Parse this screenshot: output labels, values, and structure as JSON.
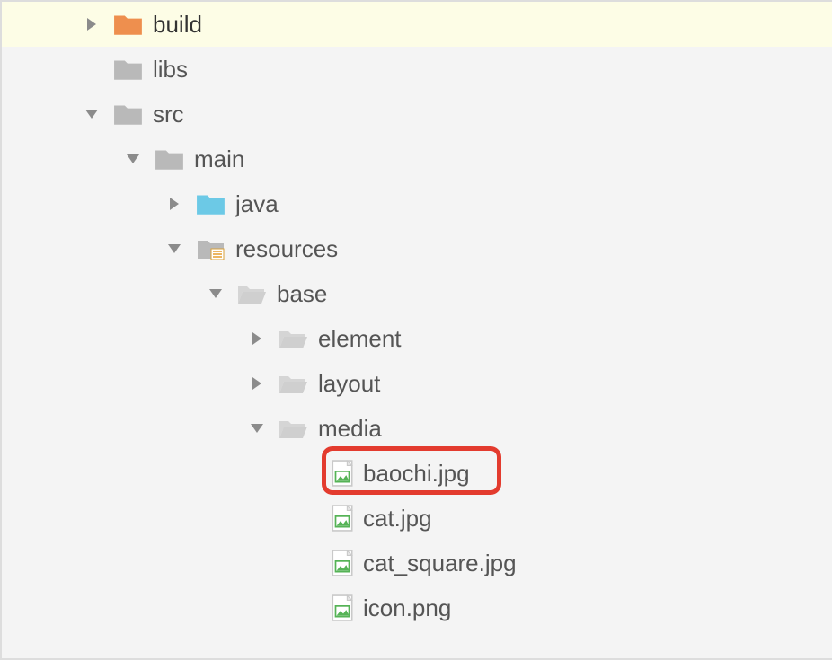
{
  "tree": {
    "build": "build",
    "libs": "libs",
    "src": "src",
    "main": "main",
    "java": "java",
    "resources": "resources",
    "base": "base",
    "element": "element",
    "layout": "layout",
    "media": "media",
    "baochi": "baochi.jpg",
    "cat": "cat.jpg",
    "cat_square": "cat_square.jpg",
    "icon_png": "icon.png"
  },
  "colors": {
    "folder_orange": "#ee8f4e",
    "folder_gray": "#b9b9b9",
    "folder_cyan": "#6cc9e6",
    "folder_light": "#cfcfcf",
    "arrow": "#8b8b8b",
    "highlight": "#e33b2e"
  }
}
